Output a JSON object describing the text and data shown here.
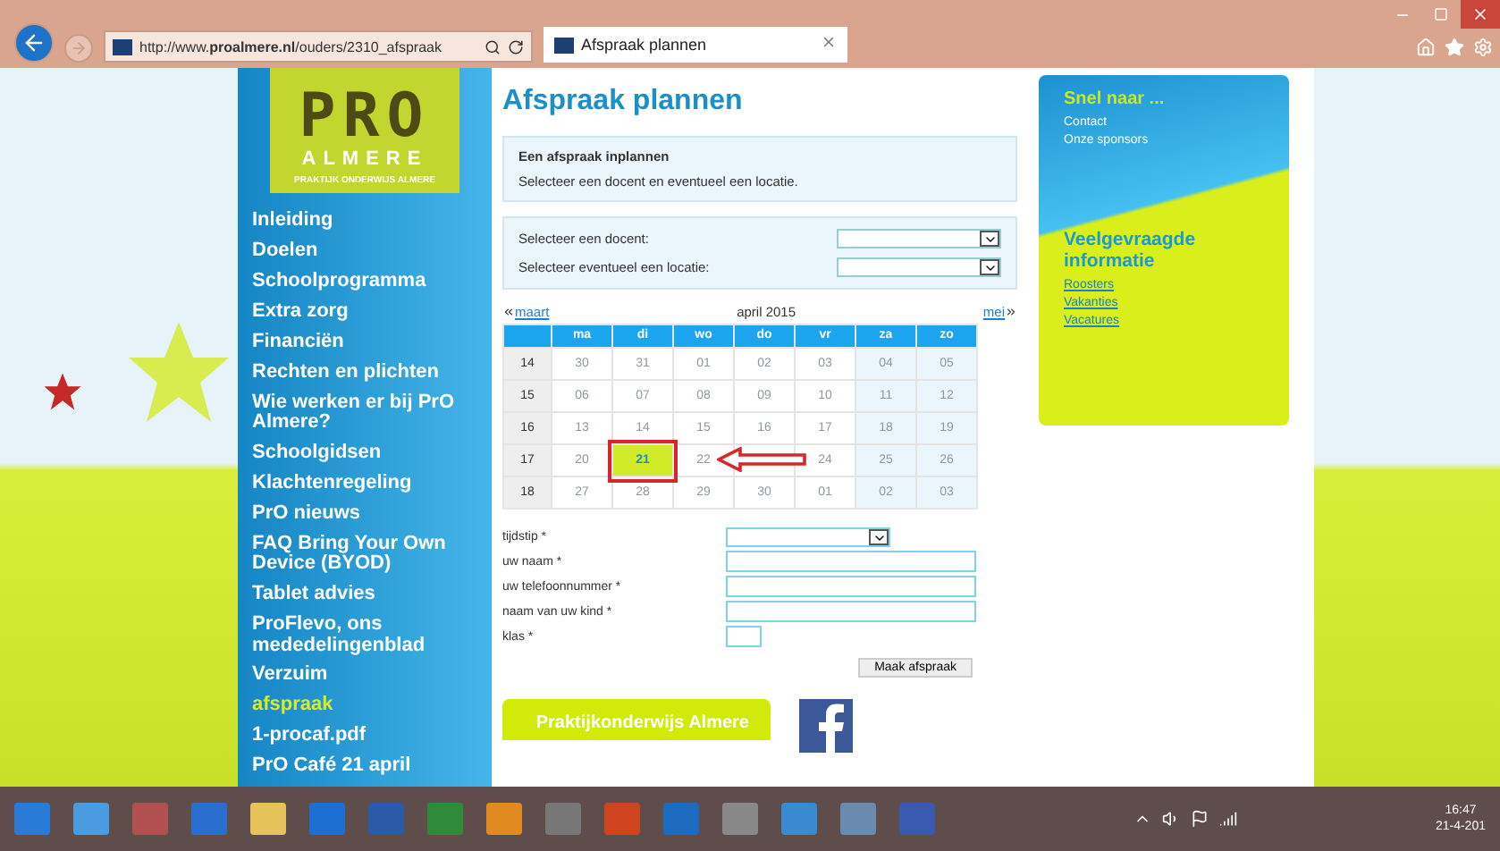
{
  "browser": {
    "address": "http://www.**proalmere.nl**/ouders/2310_afspraak",
    "tab": {
      "title": "Afspraak plannen",
      "selected": true
    }
  },
  "logo": {
    "mark": "PRO",
    "name": "ALMERE",
    "tagline": "PRAKTIJK ONDERWIJS ALMERE"
  },
  "nav": [
    {
      "label": "Inleiding",
      "selected": false
    },
    {
      "label": "Doelen",
      "selected": false
    },
    {
      "label": "Schoolprogramma",
      "selected": false
    },
    {
      "label": "Extra zorg",
      "selected": false
    },
    {
      "label": "Financiën",
      "selected": false
    },
    {
      "label": "Rechten en plichten",
      "selected": false
    },
    {
      "label": "Wie werken er bij PrO Almere?",
      "selected": false
    },
    {
      "label": "Schoolgidsen",
      "selected": false
    },
    {
      "label": "Klachtenregeling",
      "selected": false
    },
    {
      "label": "PrO nieuws",
      "selected": false
    },
    {
      "label": "FAQ Bring Your Own Device (BYOD)",
      "selected": false
    },
    {
      "label": "Tablet advies",
      "selected": false
    },
    {
      "label": "ProFlevo, ons mededelingenblad",
      "selected": false
    },
    {
      "label": "Verzuim",
      "selected": false
    },
    {
      "label": "afspraak",
      "selected": true
    },
    {
      "label": "1-procaf.pdf",
      "selected": false
    },
    {
      "label": "PrO Café 21 april",
      "selected": false
    }
  ],
  "page_title": "Afspraak plannen",
  "intro": {
    "heading": "Een afspraak inplannen",
    "text": "Selecteer een docent en eventueel een locatie."
  },
  "filters": [
    {
      "label": "Selecteer een docent:"
    },
    {
      "label": "Selecteer eventueel een locatie:"
    }
  ],
  "calendar": {
    "prev": "maart",
    "month": "april 2015",
    "next": "mei",
    "days": [
      "ma",
      "di",
      "wo",
      "do",
      "vr",
      "za",
      "zo"
    ],
    "weeks": [
      {
        "week": "14",
        "dates": [
          {
            "label": "30",
            "selected": false
          },
          {
            "label": "31",
            "selected": false
          },
          {
            "label": "01",
            "selected": false
          },
          {
            "label": "02",
            "selected": false
          },
          {
            "label": "03",
            "selected": false
          },
          {
            "label": "04",
            "selected": false
          },
          {
            "label": "05",
            "selected": false
          }
        ]
      },
      {
        "week": "15",
        "dates": [
          {
            "label": "06",
            "selected": false
          },
          {
            "label": "07",
            "selected": false
          },
          {
            "label": "08",
            "selected": false
          },
          {
            "label": "09",
            "selected": false
          },
          {
            "label": "10",
            "selected": false
          },
          {
            "label": "11",
            "selected": false
          },
          {
            "label": "12",
            "selected": false
          }
        ]
      },
      {
        "week": "16",
        "dates": [
          {
            "label": "13",
            "selected": false
          },
          {
            "label": "14",
            "selected": false
          },
          {
            "label": "15",
            "selected": false
          },
          {
            "label": "16",
            "selected": false
          },
          {
            "label": "17",
            "selected": false
          },
          {
            "label": "18",
            "selected": false
          },
          {
            "label": "19",
            "selected": false
          }
        ]
      },
      {
        "week": "17",
        "dates": [
          {
            "label": "20",
            "selected": false
          },
          {
            "label": "21",
            "selected": true
          },
          {
            "label": "22",
            "selected": false
          },
          {
            "selected": false
          },
          {
            "label": "24",
            "selected": false
          },
          {
            "label": "25",
            "selected": false
          },
          {
            "label": "26",
            "selected": false
          }
        ]
      },
      {
        "week": "18",
        "dates": [
          {
            "label": "27",
            "selected": false
          },
          {
            "label": "28",
            "selected": false
          },
          {
            "label": "29",
            "selected": false
          },
          {
            "label": "30",
            "selected": false
          },
          {
            "label": "01",
            "selected": false
          },
          {
            "label": "02",
            "selected": false
          },
          {
            "label": "03",
            "selected": false
          }
        ]
      }
    ]
  },
  "form": {
    "fields": [
      {
        "label": "tijdstip *",
        "kind": "select"
      },
      {
        "label": "uw naam *",
        "kind": "text"
      },
      {
        "label": "uw telefoonnummer *",
        "kind": "text"
      },
      {
        "label": "naam van uw kind *",
        "kind": "text"
      },
      {
        "label": "klas *",
        "kind": "short"
      }
    ],
    "submit": "Maak afspraak"
  },
  "promo": "Praktijkonderwijs Almere",
  "quick": {
    "title": "Snel naar ...",
    "links": [
      "Contact",
      "Onze sponsors"
    ]
  },
  "faq": {
    "title": "Veelgevraagde informatie",
    "links": [
      "Roosters",
      "Vakanties",
      "Vacatures"
    ]
  },
  "clock": {
    "time": "16:47",
    "date": "21-4-201"
  }
}
